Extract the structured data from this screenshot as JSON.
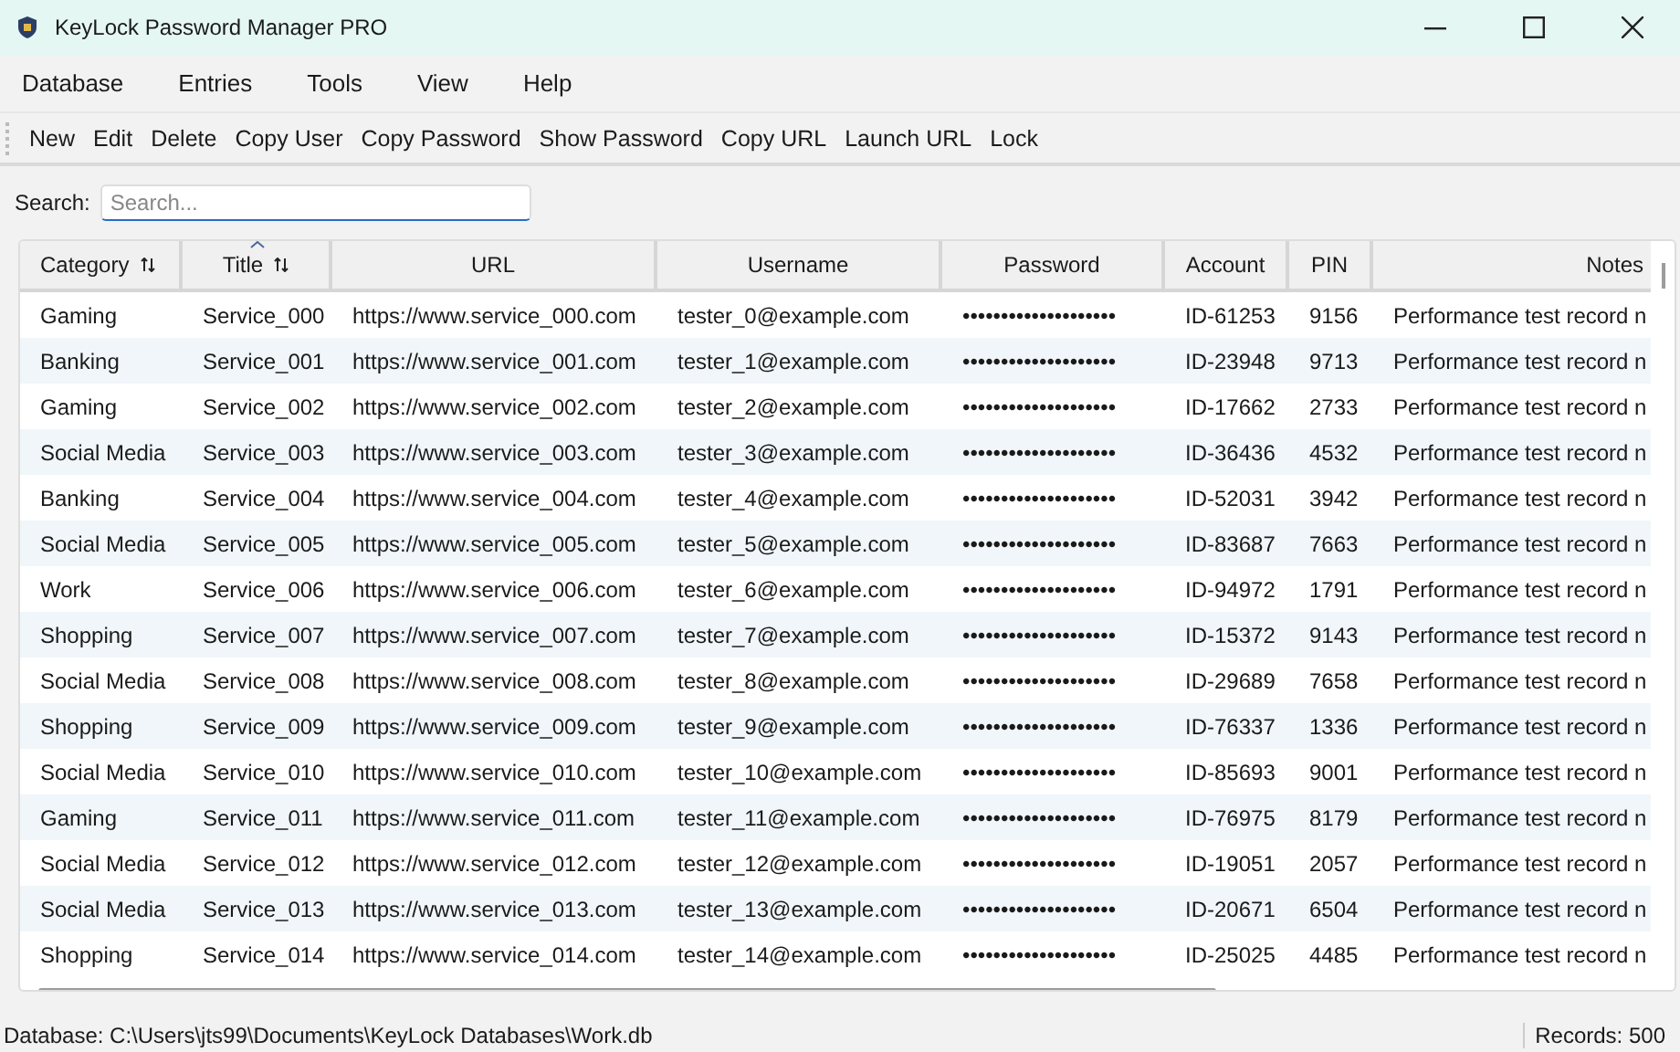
{
  "window": {
    "title": "KeyLock Password Manager PRO"
  },
  "menu": [
    "Database",
    "Entries",
    "Tools",
    "View",
    "Help"
  ],
  "toolbar": [
    "New",
    "Edit",
    "Delete",
    "Copy User",
    "Copy Password",
    "Show Password",
    "Copy URL",
    "Launch URL",
    "Lock"
  ],
  "search": {
    "label": "Search:",
    "placeholder": "Search..."
  },
  "table": {
    "columns": [
      {
        "label": "Category",
        "sortable": true,
        "sorted": false
      },
      {
        "label": "Title",
        "sortable": true,
        "sorted": true
      },
      {
        "label": "URL",
        "sortable": false,
        "sorted": false
      },
      {
        "label": "Username",
        "sortable": false,
        "sorted": false
      },
      {
        "label": "Password",
        "sortable": false,
        "sorted": false
      },
      {
        "label": "Account",
        "sortable": false,
        "sorted": false
      },
      {
        "label": "PIN",
        "sortable": false,
        "sorted": false
      },
      {
        "label": "Notes",
        "sortable": false,
        "sorted": false
      }
    ],
    "rows": [
      [
        "Gaming",
        "Service_000",
        "https://www.service_000.com",
        "tester_0@example.com",
        "••••••••••••••••••••",
        "ID-61253",
        "9156",
        "Performance test record n"
      ],
      [
        "Banking",
        "Service_001",
        "https://www.service_001.com",
        "tester_1@example.com",
        "••••••••••••••••••••",
        "ID-23948",
        "9713",
        "Performance test record n"
      ],
      [
        "Gaming",
        "Service_002",
        "https://www.service_002.com",
        "tester_2@example.com",
        "••••••••••••••••••••",
        "ID-17662",
        "2733",
        "Performance test record n"
      ],
      [
        "Social Media",
        "Service_003",
        "https://www.service_003.com",
        "tester_3@example.com",
        "••••••••••••••••••••",
        "ID-36436",
        "4532",
        "Performance test record n"
      ],
      [
        "Banking",
        "Service_004",
        "https://www.service_004.com",
        "tester_4@example.com",
        "••••••••••••••••••••",
        "ID-52031",
        "3942",
        "Performance test record n"
      ],
      [
        "Social Media",
        "Service_005",
        "https://www.service_005.com",
        "tester_5@example.com",
        "••••••••••••••••••••",
        "ID-83687",
        "7663",
        "Performance test record n"
      ],
      [
        "Work",
        "Service_006",
        "https://www.service_006.com",
        "tester_6@example.com",
        "••••••••••••••••••••",
        "ID-94972",
        "1791",
        "Performance test record n"
      ],
      [
        "Shopping",
        "Service_007",
        "https://www.service_007.com",
        "tester_7@example.com",
        "••••••••••••••••••••",
        "ID-15372",
        "9143",
        "Performance test record n"
      ],
      [
        "Social Media",
        "Service_008",
        "https://www.service_008.com",
        "tester_8@example.com",
        "••••••••••••••••••••",
        "ID-29689",
        "7658",
        "Performance test record n"
      ],
      [
        "Shopping",
        "Service_009",
        "https://www.service_009.com",
        "tester_9@example.com",
        "••••••••••••••••••••",
        "ID-76337",
        "1336",
        "Performance test record n"
      ],
      [
        "Social Media",
        "Service_010",
        "https://www.service_010.com",
        "tester_10@example.com",
        "••••••••••••••••••••",
        "ID-85693",
        "9001",
        "Performance test record n"
      ],
      [
        "Gaming",
        "Service_011",
        "https://www.service_011.com",
        "tester_11@example.com",
        "••••••••••••••••••••",
        "ID-76975",
        "8179",
        "Performance test record n"
      ],
      [
        "Social Media",
        "Service_012",
        "https://www.service_012.com",
        "tester_12@example.com",
        "••••••••••••••••••••",
        "ID-19051",
        "2057",
        "Performance test record n"
      ],
      [
        "Social Media",
        "Service_013",
        "https://www.service_013.com",
        "tester_13@example.com",
        "••••••••••••••••••••",
        "ID-20671",
        "6504",
        "Performance test record n"
      ],
      [
        "Shopping",
        "Service_014",
        "https://www.service_014.com",
        "tester_14@example.com",
        "••••••••••••••••••••",
        "ID-25025",
        "4485",
        "Performance test record n"
      ]
    ]
  },
  "status_bar": {
    "path": "Database: C:\\Users\\jts99\\Documents\\KeyLock Databases\\Work.db",
    "records": "Records: 500"
  }
}
